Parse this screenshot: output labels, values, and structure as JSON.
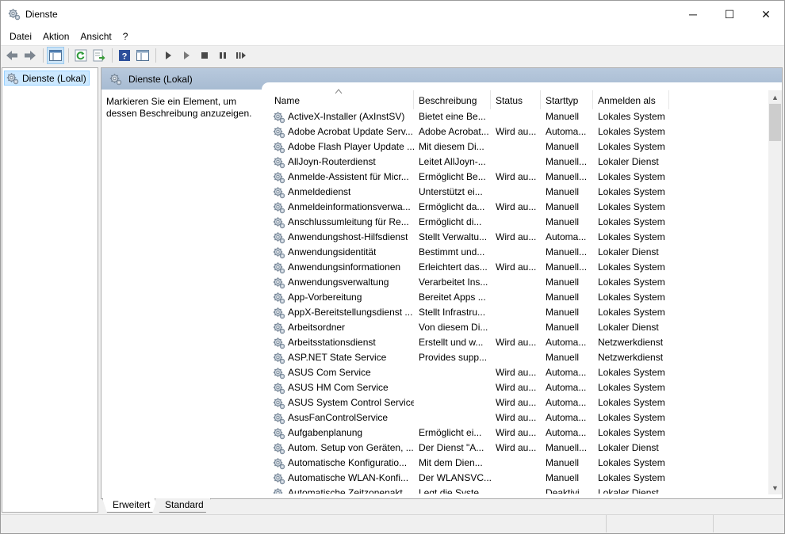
{
  "window": {
    "title": "Dienste",
    "controls": {
      "minimize": "─",
      "maximize": "☐",
      "close": "✕"
    }
  },
  "menu": [
    "Datei",
    "Aktion",
    "Ansicht",
    "?"
  ],
  "tree": {
    "root_label": "Dienste (Lokal)"
  },
  "banner": {
    "title": "Dienste (Lokal)"
  },
  "description_hint": "Markieren Sie ein Element, um dessen Beschreibung anzuzeigen.",
  "columns": {
    "name": "Name",
    "description": "Beschreibung",
    "status": "Status",
    "startup": "Starttyp",
    "logon": "Anmelden als"
  },
  "services": [
    {
      "name": "ActiveX-Installer (AxInstSV)",
      "description": "Bietet eine Be...",
      "status": "",
      "startup": "Manuell",
      "logon": "Lokales System"
    },
    {
      "name": "Adobe Acrobat Update Serv...",
      "description": "Adobe Acrobat...",
      "status": "Wird au...",
      "startup": "Automa...",
      "logon": "Lokales System"
    },
    {
      "name": "Adobe Flash Player Update ...",
      "description": "Mit diesem Di...",
      "status": "",
      "startup": "Manuell",
      "logon": "Lokales System"
    },
    {
      "name": "AllJoyn-Routerdienst",
      "description": "Leitet AllJoyn-...",
      "status": "",
      "startup": "Manuell...",
      "logon": "Lokaler Dienst"
    },
    {
      "name": "Anmelde-Assistent für Micr...",
      "description": "Ermöglicht Be...",
      "status": "Wird au...",
      "startup": "Manuell...",
      "logon": "Lokales System"
    },
    {
      "name": "Anmeldedienst",
      "description": "Unterstützt ei...",
      "status": "",
      "startup": "Manuell",
      "logon": "Lokales System"
    },
    {
      "name": "Anmeldeinformationsverwa...",
      "description": "Ermöglicht da...",
      "status": "Wird au...",
      "startup": "Manuell",
      "logon": "Lokales System"
    },
    {
      "name": "Anschlussumleitung für Re...",
      "description": "Ermöglicht di...",
      "status": "",
      "startup": "Manuell",
      "logon": "Lokales System"
    },
    {
      "name": "Anwendungshost-Hilfsdienst",
      "description": "Stellt Verwaltu...",
      "status": "Wird au...",
      "startup": "Automa...",
      "logon": "Lokales System"
    },
    {
      "name": "Anwendungsidentität",
      "description": "Bestimmt und...",
      "status": "",
      "startup": "Manuell...",
      "logon": "Lokaler Dienst"
    },
    {
      "name": "Anwendungsinformationen",
      "description": "Erleichtert das...",
      "status": "Wird au...",
      "startup": "Manuell...",
      "logon": "Lokales System"
    },
    {
      "name": "Anwendungsverwaltung",
      "description": "Verarbeitet Ins...",
      "status": "",
      "startup": "Manuell",
      "logon": "Lokales System"
    },
    {
      "name": "App-Vorbereitung",
      "description": "Bereitet Apps ...",
      "status": "",
      "startup": "Manuell",
      "logon": "Lokales System"
    },
    {
      "name": "AppX-Bereitstellungsdienst ...",
      "description": "Stellt Infrastru...",
      "status": "",
      "startup": "Manuell",
      "logon": "Lokales System"
    },
    {
      "name": "Arbeitsordner",
      "description": "Von diesem Di...",
      "status": "",
      "startup": "Manuell",
      "logon": "Lokaler Dienst"
    },
    {
      "name": "Arbeitsstationsdienst",
      "description": "Erstellt und w...",
      "status": "Wird au...",
      "startup": "Automa...",
      "logon": "Netzwerkdienst"
    },
    {
      "name": "ASP.NET State Service",
      "description": "Provides supp...",
      "status": "",
      "startup": "Manuell",
      "logon": "Netzwerkdienst"
    },
    {
      "name": "ASUS Com Service",
      "description": "",
      "status": "Wird au...",
      "startup": "Automa...",
      "logon": "Lokales System"
    },
    {
      "name": "ASUS HM Com Service",
      "description": "",
      "status": "Wird au...",
      "startup": "Automa...",
      "logon": "Lokales System"
    },
    {
      "name": "ASUS System Control Service",
      "description": "",
      "status": "Wird au...",
      "startup": "Automa...",
      "logon": "Lokales System"
    },
    {
      "name": "AsusFanControlService",
      "description": "",
      "status": "Wird au...",
      "startup": "Automa...",
      "logon": "Lokales System"
    },
    {
      "name": "Aufgabenplanung",
      "description": "Ermöglicht ei...",
      "status": "Wird au...",
      "startup": "Automa...",
      "logon": "Lokales System"
    },
    {
      "name": "Autom. Setup von Geräten, ...",
      "description": "Der Dienst \"A...",
      "status": "Wird au...",
      "startup": "Manuell...",
      "logon": "Lokaler Dienst"
    },
    {
      "name": "Automatische Konfiguratio...",
      "description": "Mit dem Dien...",
      "status": "",
      "startup": "Manuell",
      "logon": "Lokales System"
    },
    {
      "name": "Automatische WLAN-Konfi...",
      "description": "Der WLANSVC...",
      "status": "",
      "startup": "Manuell",
      "logon": "Lokales System"
    },
    {
      "name": "Automatische Zeitzonenakt...",
      "description": "Legt die Syste...",
      "status": "",
      "startup": "Deaktivi...",
      "logon": "Lokaler Dienst"
    }
  ],
  "tabs": [
    "Erweitert",
    "Standard"
  ]
}
